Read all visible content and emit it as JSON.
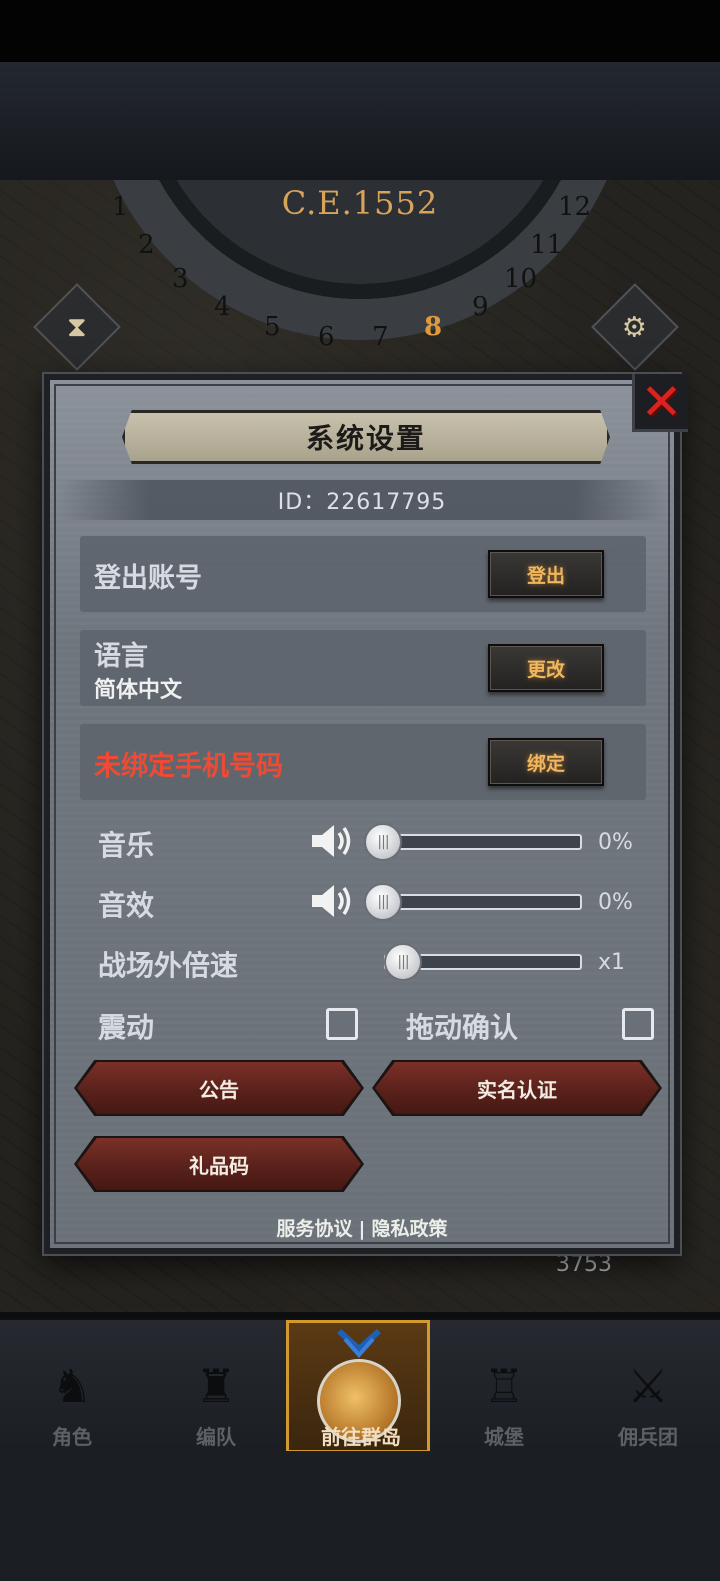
{
  "backdrop": {
    "era_label": "C.E.1552",
    "clock_numbers": [
      "1",
      "2",
      "3",
      "4",
      "5",
      "6",
      "7",
      "8",
      "9",
      "10",
      "11",
      "12"
    ],
    "active_clock_number": "8"
  },
  "dialog": {
    "title": "系统设置",
    "close_icon": "close-x-icon",
    "player_id": "ID：22617795",
    "logout": {
      "label": "登出账号",
      "button": "登出"
    },
    "language": {
      "label": "语言",
      "value": "简体中文",
      "button": "更改"
    },
    "phone": {
      "label": "未绑定手机号码",
      "button": "绑定"
    },
    "music": {
      "label": "音乐",
      "value_text": "0%",
      "level": 0
    },
    "sound_effects": {
      "label": "音效",
      "value_text": "0%",
      "level": 0
    },
    "battle_speed": {
      "label": "战场外倍速",
      "value_text": "x1"
    },
    "vibration": {
      "label": "震动",
      "checked": false
    },
    "drag_confirm": {
      "label": "拖动确认",
      "checked": false
    },
    "buttons": {
      "announcement": "公告",
      "real_name": "实名认证",
      "gift_code": "礼品码"
    },
    "footer": {
      "terms": "服务协议",
      "separator": "|",
      "privacy": "隐私政策"
    }
  },
  "hud": {
    "resource_count": "3753"
  },
  "bottom_nav": {
    "items": [
      {
        "label": "角色",
        "icon": "knight-helmet-icon"
      },
      {
        "label": "编队",
        "icon": "formation-icon"
      },
      {
        "label": "前往群岛",
        "icon": "globe-icon",
        "active": true
      },
      {
        "label": "城堡",
        "icon": "castle-icon"
      },
      {
        "label": "佣兵团",
        "icon": "mercenary-icon"
      }
    ]
  },
  "colors": {
    "accent_orange": "#f0b75e",
    "warning_red": "#ef4a33",
    "close_red": "#d8231e",
    "nav_active_border": "#d29a2e"
  }
}
